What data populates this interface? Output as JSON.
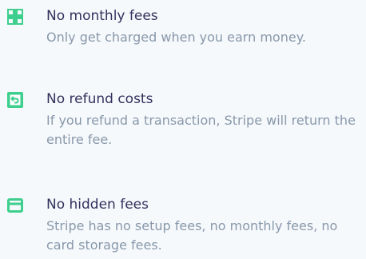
{
  "accent_color": "#3ecf8e",
  "features": [
    {
      "icon": "grid-icon",
      "title": "No monthly fees",
      "description": "Only get charged when you earn money."
    },
    {
      "icon": "refund-icon",
      "title": "No refund costs",
      "description": "If you refund a transaction, Stripe will return the entire fee."
    },
    {
      "icon": "card-icon",
      "title": "No hidden fees",
      "description": "Stripe has no setup fees, no monthly fees, no card storage fees."
    }
  ]
}
